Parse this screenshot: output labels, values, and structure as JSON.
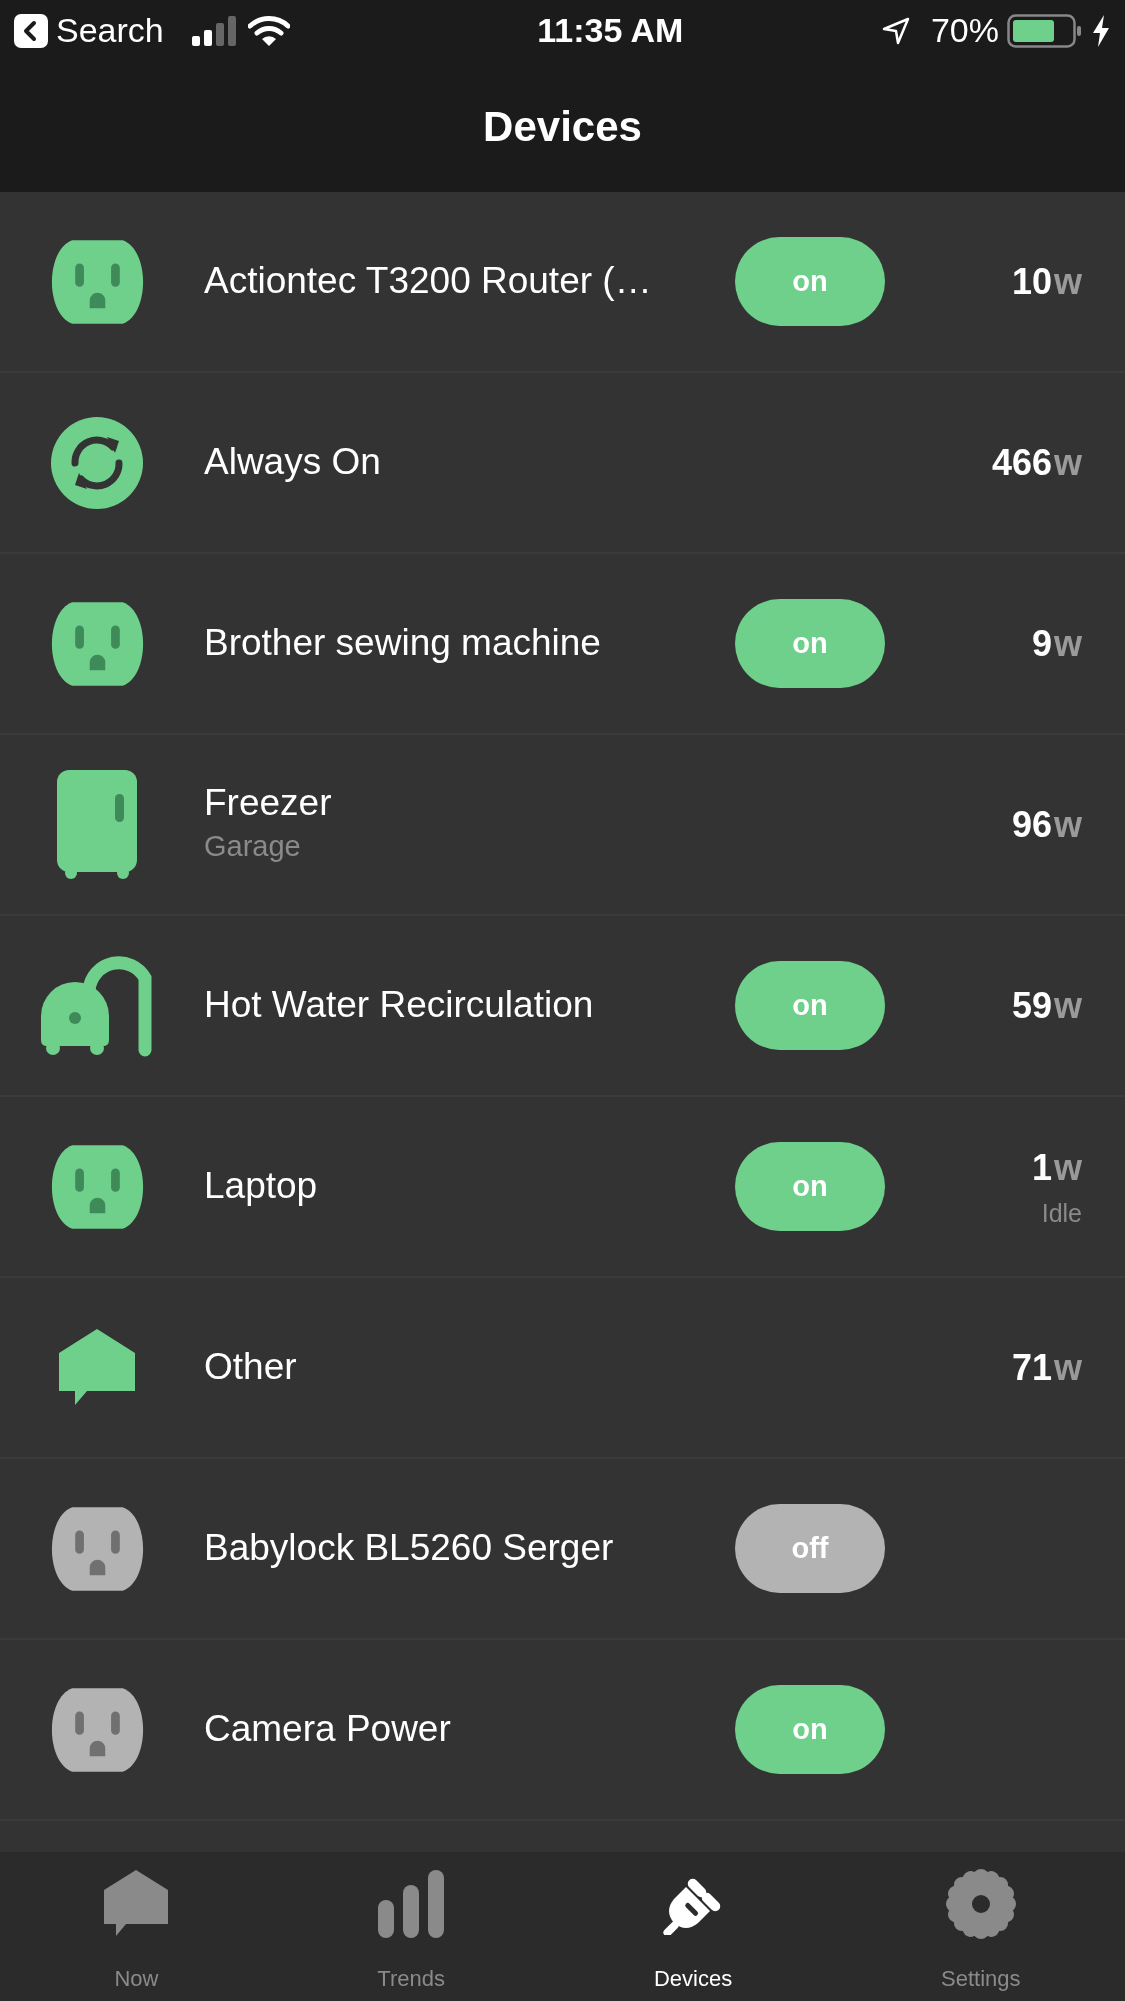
{
  "status_bar": {
    "back_label": "Search",
    "time": "11:35 AM",
    "battery": "70%"
  },
  "title": "Devices",
  "devices": [
    {
      "kind": "outlet",
      "name": "Actiontec T3200 Router (…",
      "active": true,
      "toggle": {
        "label": "on",
        "on": true
      },
      "watts": "10",
      "unit": "w"
    },
    {
      "kind": "sync",
      "name": "Always On",
      "active": true,
      "watts": "466",
      "unit": "w"
    },
    {
      "kind": "outlet",
      "name": "Brother sewing machine",
      "active": true,
      "toggle": {
        "label": "on",
        "on": true
      },
      "watts": "9",
      "unit": "w"
    },
    {
      "kind": "fridge",
      "name": "Freezer",
      "subtitle": "Garage",
      "active": true,
      "watts": "96",
      "unit": "w"
    },
    {
      "kind": "pump",
      "name": "Hot Water Recirculation",
      "active": true,
      "toggle": {
        "label": "on",
        "on": true
      },
      "watts": "59",
      "unit": "w"
    },
    {
      "kind": "outlet",
      "name": "Laptop",
      "active": true,
      "toggle": {
        "label": "on",
        "on": true
      },
      "watts": "1",
      "unit": "w",
      "note": "Idle"
    },
    {
      "kind": "house",
      "name": "Other",
      "active": true,
      "watts": "71",
      "unit": "w"
    },
    {
      "kind": "outlet",
      "name": "Babylock BL5260 Serger",
      "active": false,
      "toggle": {
        "label": "off",
        "on": false
      }
    },
    {
      "kind": "outlet",
      "name": "Camera Power",
      "active": false,
      "toggle": {
        "label": "on",
        "on": true
      }
    }
  ],
  "tabs": [
    {
      "kind": "now",
      "label": "Now",
      "selected": false
    },
    {
      "kind": "trends",
      "label": "Trends",
      "selected": false
    },
    {
      "kind": "devices",
      "label": "Devices",
      "selected": true
    },
    {
      "kind": "settings",
      "label": "Settings",
      "selected": false
    }
  ]
}
